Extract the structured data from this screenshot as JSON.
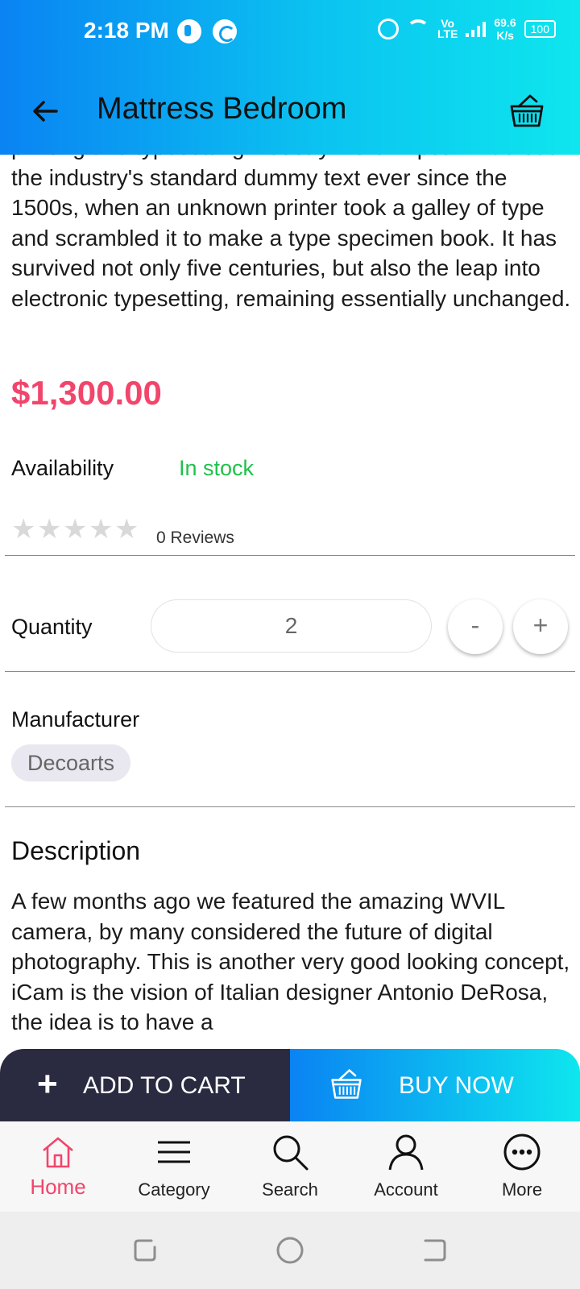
{
  "status_bar": {
    "time": "2:18 PM",
    "network_top": "Vo",
    "network_bottom": "LTE",
    "speed_value": "69.6",
    "speed_unit": "K/s",
    "battery": "100"
  },
  "header": {
    "title": "Mattress Bedroom"
  },
  "product": {
    "intro_text": "printing and typesetting industry. Lorem Ipsum has been the industry's standard dummy text ever since the 1500s, when an unknown printer took a galley of type and scrambled it to make a type specimen book. It has survived not only five centuries, but also the leap into electronic typesetting, remaining essentially unchanged.",
    "price": "$1,300.00",
    "availability_label": "Availability",
    "availability_value": "In stock",
    "rating": 0,
    "reviews": "0 Reviews",
    "quantity_label": "Quantity",
    "quantity_value": "2",
    "minus_label": "-",
    "plus_label": "+",
    "manufacturer_label": "Manufacturer",
    "manufacturer_value": "Decoarts",
    "description_title": "Description",
    "description_text": "A few months ago we featured the amazing WVIL camera, by many considered the future of digital photography. This is another very good looking concept, iCam is the vision of Italian designer Antonio DeRosa, the idea is to have a"
  },
  "actions": {
    "add_to_cart": "ADD TO CART",
    "buy_now": "BUY NOW"
  },
  "bottom_nav": {
    "items": [
      {
        "label": "Home",
        "icon": "home-icon",
        "active": true
      },
      {
        "label": "Category",
        "icon": "menu-icon",
        "active": false
      },
      {
        "label": "Search",
        "icon": "search-icon",
        "active": false
      },
      {
        "label": "Account",
        "icon": "account-icon",
        "active": false
      },
      {
        "label": "More",
        "icon": "more-icon",
        "active": false
      }
    ]
  },
  "colors": {
    "accent_pink": "#f2456c",
    "in_stock_green": "#1fc24a",
    "header_gradient_start": "#0a83f3",
    "header_gradient_end": "#0ee6ee",
    "add_cart_dark": "#2a2b40"
  }
}
